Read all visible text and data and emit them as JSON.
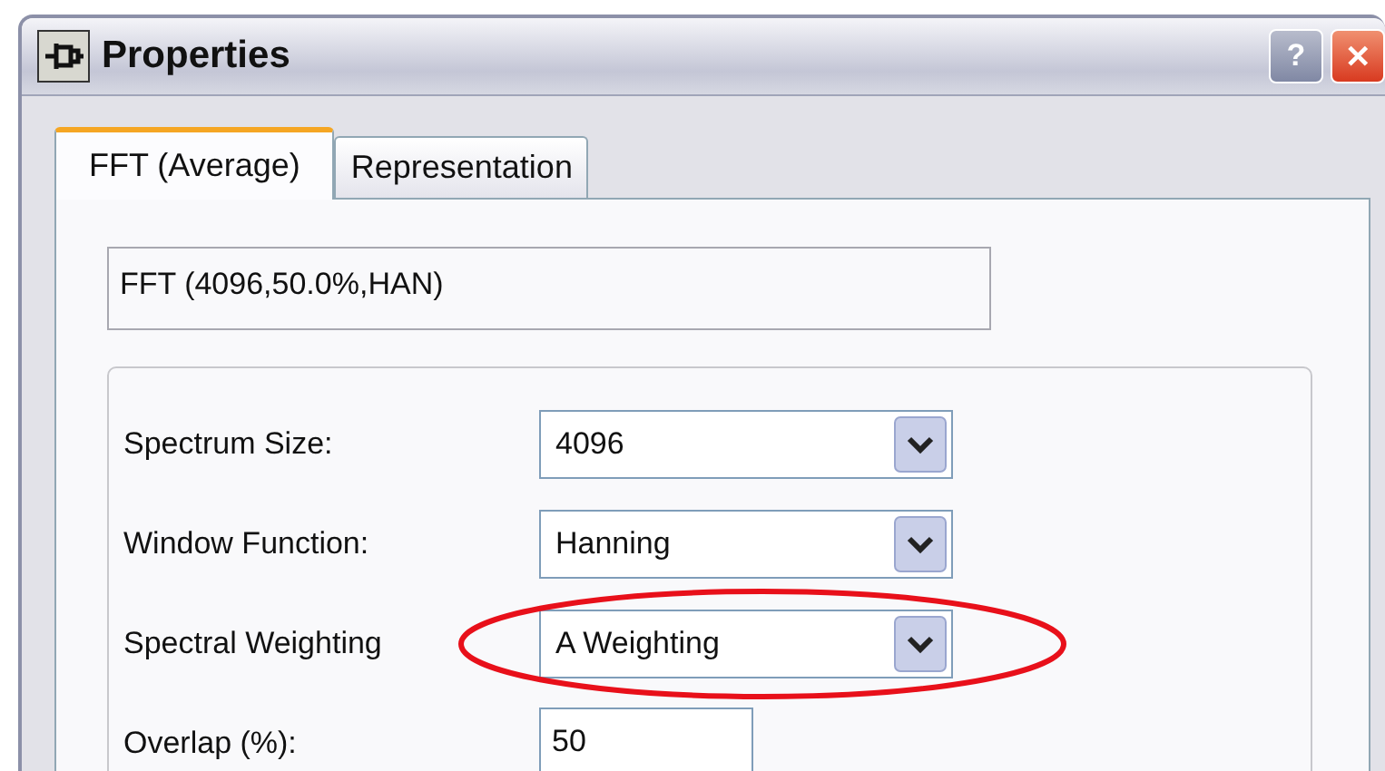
{
  "window": {
    "title": "Properties",
    "buttons": [
      {
        "kind": "help",
        "label": "?"
      },
      {
        "kind": "close",
        "label": "✕"
      }
    ]
  },
  "tabs": [
    {
      "label": "FFT (Average)",
      "selected": true
    },
    {
      "label": "Representation",
      "selected": false
    }
  ],
  "description": {
    "value": "FFT (4096,50.0%,HAN)"
  },
  "settings": [
    {
      "kind": "combo",
      "label": "Spectrum Size:",
      "value": "4096",
      "circled": false
    },
    {
      "kind": "combo",
      "label": "Window Function:",
      "value": "Hanning",
      "circled": false
    },
    {
      "kind": "combo",
      "label": "Spectral Weighting",
      "value": "A Weighting",
      "circled": true
    },
    {
      "kind": "field",
      "label": "Overlap (%):",
      "value": "50",
      "circled": false
    }
  ]
}
